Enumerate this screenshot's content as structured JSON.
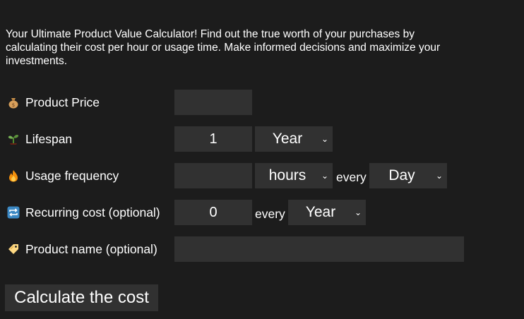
{
  "intro": {
    "text": "Your Ultimate Product Value Calculator! Find out the true worth of your purchases by calculating their cost per hour or usage time. Make informed decisions and maximize your investments."
  },
  "form": {
    "price": {
      "label": "Product Price",
      "icon": "money-bag-icon",
      "value": ""
    },
    "lifespan": {
      "label": "Lifespan",
      "icon": "seedling-icon",
      "value": "1",
      "unit": "Year"
    },
    "usage": {
      "label": "Usage frequency",
      "icon": "fire-icon",
      "value": "",
      "unit": "hours",
      "every_label": "every",
      "period": "Day"
    },
    "recurring": {
      "label": "Recurring cost (optional)",
      "icon": "repeat-icon",
      "value": "0",
      "every_label": "every",
      "period": "Year"
    },
    "name": {
      "label": "Product name (optional)",
      "icon": "tag-icon",
      "value": ""
    }
  },
  "button": {
    "label": "Calculate the cost"
  },
  "colors": {
    "background": "#1c1c1c",
    "field": "#313131",
    "text": "#ffffff"
  }
}
